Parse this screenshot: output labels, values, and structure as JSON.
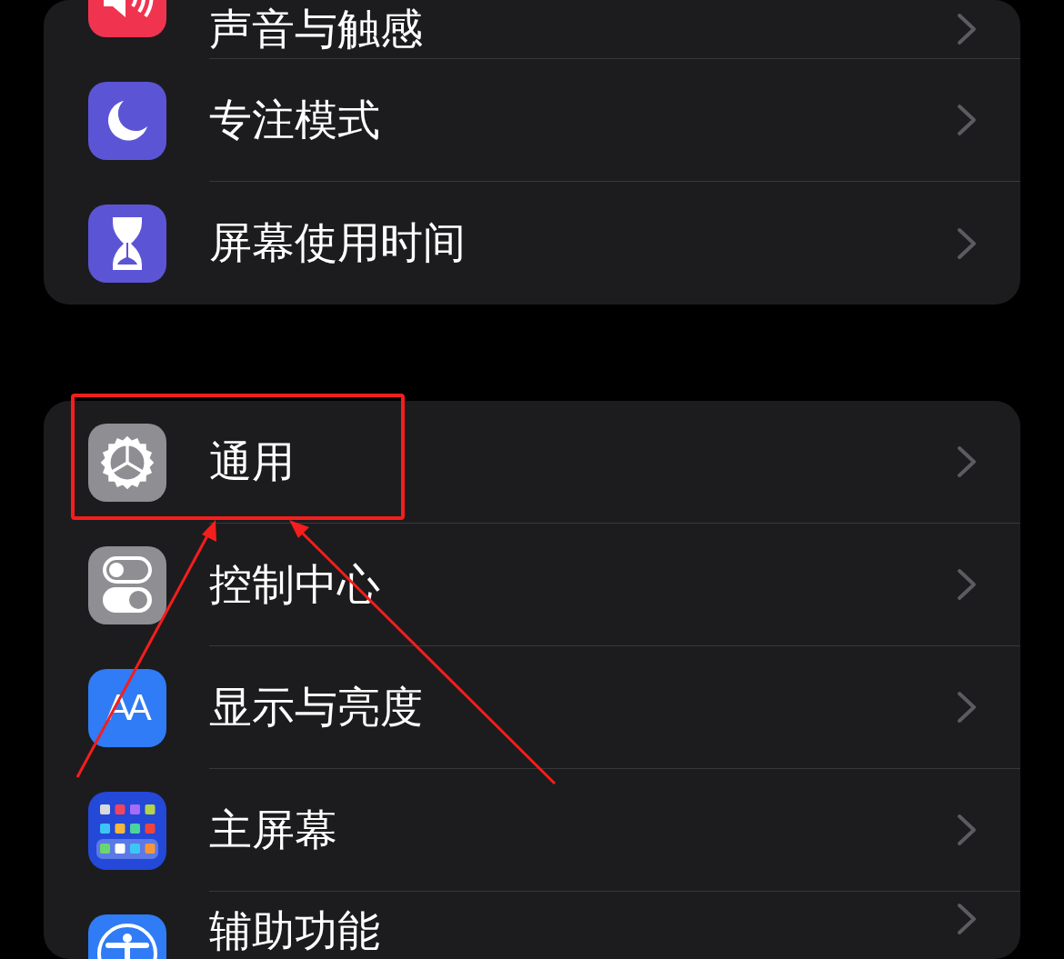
{
  "groups": [
    {
      "rows": [
        {
          "kind": "sound",
          "label": "声音与触感",
          "color": "#f0344f",
          "highlighted": false
        },
        {
          "kind": "moon",
          "label": "专注模式",
          "color": "#5b55d6",
          "highlighted": false
        },
        {
          "kind": "hourglass",
          "label": "屏幕使用时间",
          "color": "#5b55d6",
          "highlighted": false
        }
      ]
    },
    {
      "rows": [
        {
          "kind": "gear",
          "label": "通用",
          "color": "#8e8e93",
          "highlighted": true
        },
        {
          "kind": "toggles",
          "label": "控制中心",
          "color": "#8e8e93",
          "highlighted": false
        },
        {
          "kind": "text-size",
          "label": "显示与亮度",
          "color": "#2f7cf6",
          "highlighted": false,
          "icon_text": "AA"
        },
        {
          "kind": "home-grid",
          "label": "主屏幕",
          "color": "#2448d8",
          "highlighted": false
        },
        {
          "kind": "accessibility",
          "label": "辅助功能",
          "color": "#2f7cf6",
          "highlighted": false
        }
      ]
    }
  ]
}
